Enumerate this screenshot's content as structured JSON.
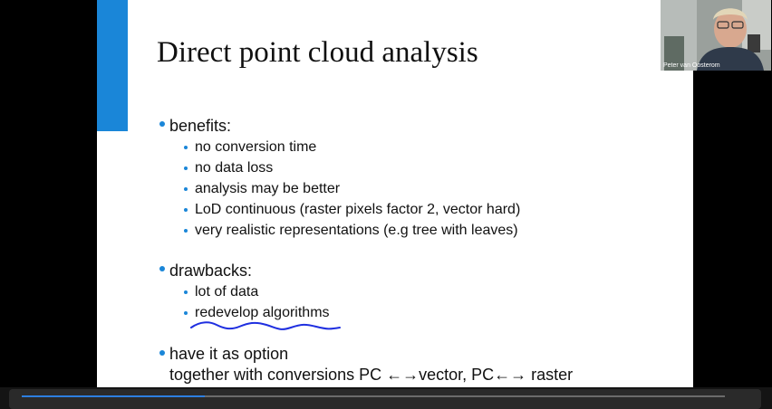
{
  "slide": {
    "title": "Direct point cloud analysis",
    "accent_color": "#1a86d8",
    "bullet_color": "#1a86d8",
    "sections": [
      {
        "label": "benefits:",
        "items": [
          "no conversion time",
          "no data loss",
          "analysis may be better",
          "LoD continuous (raster pixels factor 2, vector hard)",
          "very realistic representations (e.g tree with leaves)"
        ]
      },
      {
        "label": "drawbacks:",
        "items": [
          "lot of data",
          "redevelop algorithms"
        ]
      },
      {
        "label": "have it as option",
        "continuation": "together with conversions PC ←→vector, PC←→ raster"
      }
    ],
    "annotation_color": "#1f2fe0"
  },
  "webcam": {
    "participant_name": "Peter van Oosterom"
  },
  "playback": {
    "progress": 0.26,
    "progress_color": "#2d7fe0"
  }
}
